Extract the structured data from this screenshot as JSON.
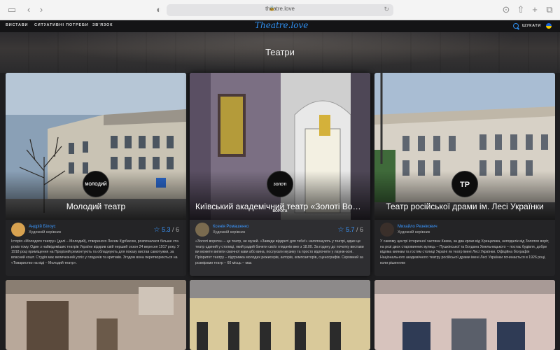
{
  "browser": {
    "url": "theatre.love"
  },
  "nav": {
    "items": [
      "ВИСТАВИ",
      "СИТУАТИВНІ ПОТРЕБИ",
      "ЗВ'ЯЗОК"
    ],
    "logo": "Theatre.love",
    "search_label": "ШУКАТИ"
  },
  "hero": {
    "title": "Театри"
  },
  "cards": [
    {
      "title": "Молодий театр",
      "logo_text": "МОЛОДИЙ",
      "person_name": "Андрій Білоус",
      "person_role": "Художній керівник",
      "rating": "5.3",
      "rating_max": "/ 6",
      "description": "Історія «Молодого театру» (далі – Молодий), створеного Лесем Курбасом, розпочалася більше ста років тому. Один з найвідоміших театрів України відкрив свій перший сезон 24 вересня 1917 року. У 1918 році приміщення на Прорізній ремонтують та обладнують для показу вистав самотужки, за власний кошт. Студія має величезний успіх у глядачів та критиків. Згодом вона перетворюється на «Товариство на віді – Молодий театр»."
    },
    {
      "title": "Київський академічний театр «Золоті Ворота»",
      "logo_text": "ЗОЛОТІ ВОРОТА",
      "person_name": "Ксенія Ромашенко",
      "person_role": "Художній керівник",
      "rating": "5.7",
      "rating_max": "/ 6",
      "description": "«Золоті ворота» – це театр, не музей. «Завжди відкриті для тебе!» наголошують у театрі, адже це театр єдиний у столиці, який радий бачити своїх глядачів вже з 18.00. За годину до початку вистави ви можете випити смачної кави або вина, послухати музику та просто відпочити у лаунж-зоні. Пріоритет театру – підтримка молодих режисерів, акторів, композиторів, сценографів. Скромний за розмірами театр – 60 місць – має"
    },
    {
      "title": "Театр російської драми ім. Лесі Українки",
      "logo_text": "ТР",
      "person_name": "Михайло Резнікович",
      "person_role": "Художній керівник",
      "rating": "",
      "rating_max": "",
      "description": "У самому центрі історичної частини Києва, за два кроки від Хрещатика, неподалік від Золотих воріт, на розі двох старовинних вулиць – Пушкінської та Богдана Хмельницького – постає будівля, добре відома киянам та гостям столиці Україні як театр імені Лесі Українки. Офіційна біографія Національного академічного театру російської драми імені Лесі Українки починається в 1926 році, коли рішенням"
    }
  ],
  "colors": {
    "accent": "#3a97ff",
    "background": "#1e1e20"
  }
}
